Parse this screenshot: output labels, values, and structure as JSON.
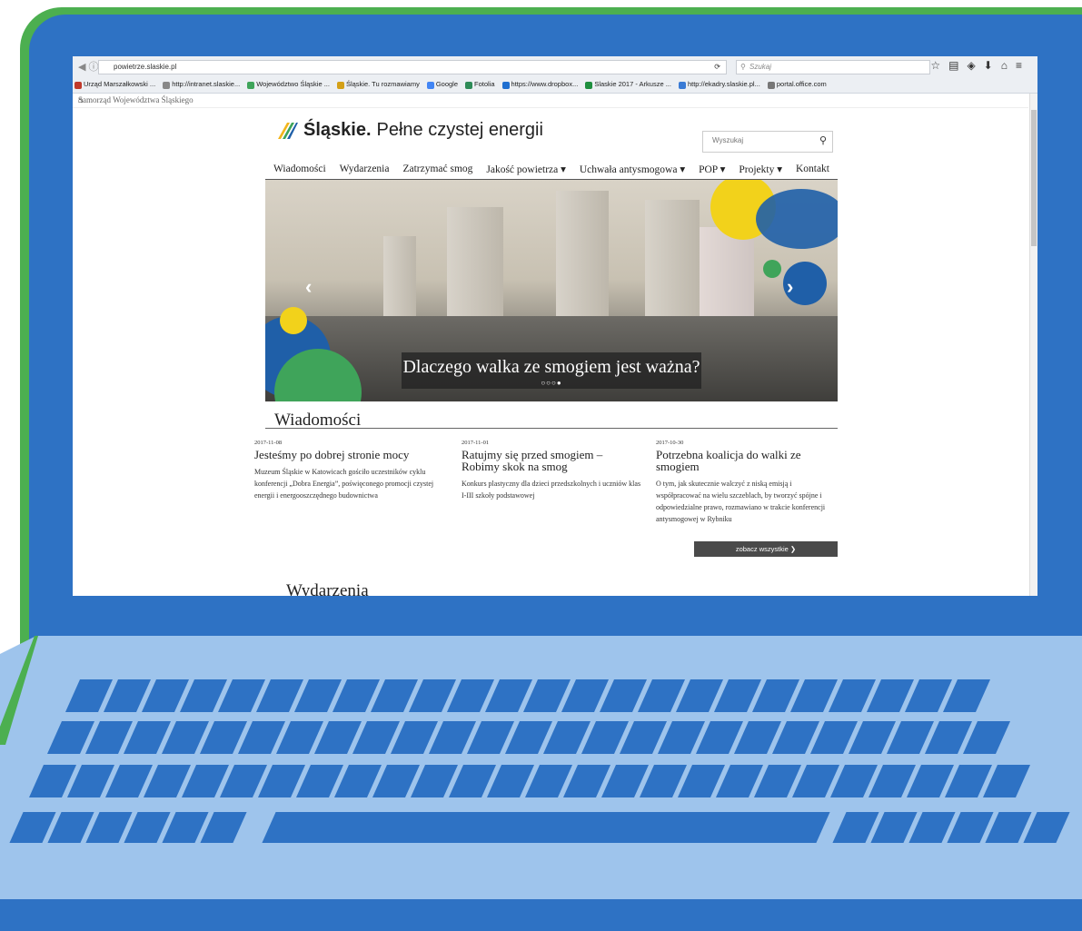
{
  "browser": {
    "url": "powietrze.slaskie.pl",
    "search_placeholder": "Szukaj",
    "bookmarks": [
      "Urząd Marszałkowski ...",
      "http://intranet.slaskie...",
      "Województwo Śląskie ...",
      "Śląskie. Tu rozmawiamy",
      "Google",
      "Fotolia",
      "https://www.dropbox...",
      "Slaskie 2017 - Arkusze ...",
      "http://ekadry.slaskie.pl...",
      "portal.office.com"
    ]
  },
  "site": {
    "topbar_title": "Samorząd Województwa Śląskiego",
    "logo_title": "Śląskie.",
    "logo_tagline": "Pełne czystej energii",
    "search_placeholder": "Wyszukaj",
    "nav": [
      "Wiadomości",
      "Wydarzenia",
      "Zatrzymać smog",
      "Jakość powietrza ▾",
      "Uchwała antysmogowa ▾",
      "POP ▾",
      "Projekty ▾",
      "Kontakt"
    ],
    "hero_caption": "Dlaczego walka ze smogiem jest ważna?",
    "slider_dots": "○○○●",
    "news_heading": "Wiadomości",
    "news": [
      {
        "date": "2017-11-08",
        "title": "Jesteśmy po dobrej stronie mocy",
        "lead": "Muzeum Śląskie w Katowicach gościło uczestników cyklu konferencji „Dobra Energia”, poświęconego promocji czystej energii i energooszczędnego budownictwa"
      },
      {
        "date": "2017-11-01",
        "title": "Ratujmy się przed smogiem – Robimy skok na smog",
        "lead": "Konkurs plastyczny dla dzieci przedszkolnych i uczniów klas I-III szkoły podstawowej"
      },
      {
        "date": "2017-10-30",
        "title": "Potrzebna koalicja do walki ze smogiem",
        "lead": "O tym, jak skutecznie walczyć z niską emisją i współpracować na wielu szczeblach, by tworzyć spójne i odpowiedzialne prawo, rozmawiano w trakcie konferencji antysmogowej w Rybniku"
      }
    ],
    "more_button": "zobacz wszystkie ❯",
    "events_heading": "Wydarzenia"
  },
  "colors": {
    "laptop_blue": "#2e72c4",
    "laptop_green": "#4caf50",
    "deck_light": "#9ec4ec",
    "accent_yellow": "#f2d21b",
    "accent_blue": "#1f5fa8",
    "accent_green": "#3fa45a"
  },
  "icons": [
    "back-icon",
    "reload-icon",
    "search-icon",
    "star-icon",
    "reading-list-icon",
    "pocket-icon",
    "download-icon",
    "home-icon",
    "menu-icon",
    "logo-icon",
    "slider-prev-icon",
    "slider-next-icon"
  ]
}
